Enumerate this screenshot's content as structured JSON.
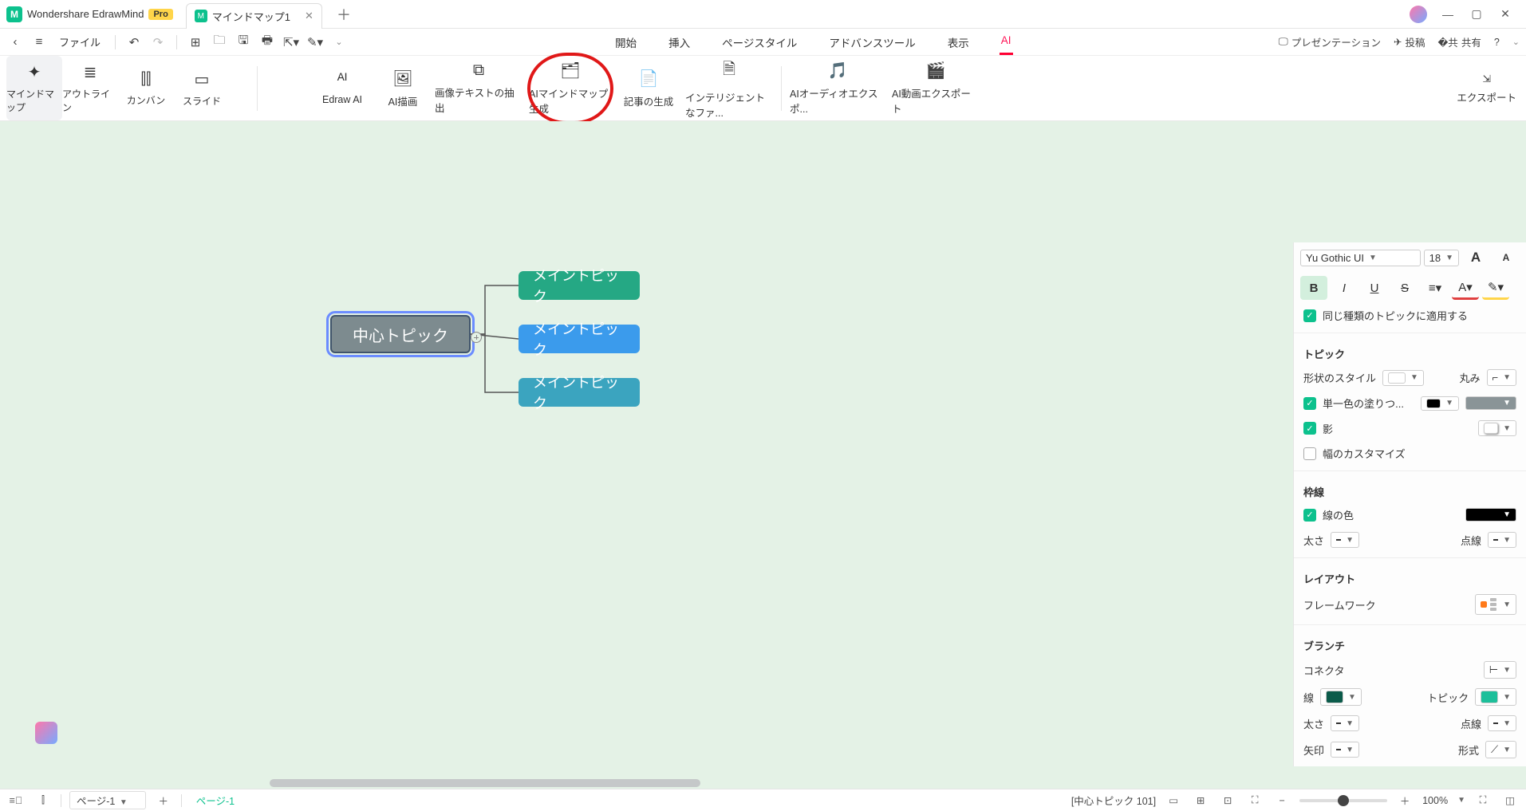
{
  "app": {
    "name": "Wondershare EdrawMind",
    "pro": "Pro"
  },
  "tabs": {
    "doc": "マインドマップ1"
  },
  "toolbar": {
    "file": "ファイル"
  },
  "menu": {
    "start": "開始",
    "insert": "挿入",
    "pagestyle": "ページスタイル",
    "advanced": "アドバンスツール",
    "view": "表示",
    "ai": "AI"
  },
  "actions": {
    "presentation": "プレゼンテーション",
    "post": "投稿",
    "share": "共有"
  },
  "views": {
    "mindmap": "マインドマップ",
    "outline": "アウトライン",
    "kanban": "カンバン",
    "slide": "スライド"
  },
  "ai_tools": {
    "edraw_ai": "Edraw AI",
    "ai_draw": "AI描画",
    "img_text": "画像テキストの抽出",
    "mm_gen": "AIマインドマップ生成",
    "article": "記事の生成",
    "intel": "インテリジェントなファ...",
    "audio": "AIオーディオエクスポ...",
    "video": "AI動画エクスポート"
  },
  "export": "エクスポート",
  "nodes": {
    "center": "中心トピック",
    "main1": "メイントピック",
    "main2": "メイントピック",
    "main3": "メイントピック"
  },
  "panel": {
    "font_name": "Yu Gothic UI",
    "font_size": "18",
    "apply_same": "同じ種類のトピックに適用する",
    "topic": "トピック",
    "shape_style": "形状のスタイル",
    "rounding": "丸み",
    "solid_fill": "単一色の塗りつ...",
    "shadow": "影",
    "width_custom": "幅のカスタマイズ",
    "border": "枠線",
    "line_color": "線の色",
    "thickness": "太さ",
    "dash": "点線",
    "layout": "レイアウト",
    "framework": "フレームワーク",
    "branch": "ブランチ",
    "connector": "コネクタ",
    "line": "線",
    "topic2": "トピック",
    "arrow": "矢印",
    "format": "形式"
  },
  "status": {
    "page_sel": "ページ-1",
    "page_tab": "ページ-1",
    "selection": "[中心トピック 101]",
    "zoom": "100%"
  }
}
